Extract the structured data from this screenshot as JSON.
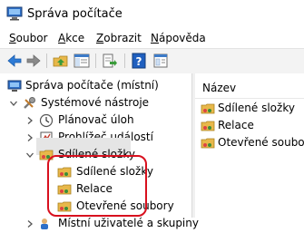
{
  "window": {
    "title": "Správa počítače"
  },
  "menu": [
    {
      "label": "Soubor",
      "key": "S",
      "rest": "oubor"
    },
    {
      "label": "Akce",
      "key": "A",
      "rest": "kce"
    },
    {
      "label": "Zobrazit",
      "key": "Z",
      "rest": "obrazit"
    },
    {
      "label": "Nápověda",
      "key": "N",
      "rest": "ápověda"
    }
  ],
  "toolbar": {
    "buttons": [
      "back-icon",
      "forward-icon",
      "up-folder-icon",
      "show-hide-tree-icon",
      "export-list-icon",
      "help-icon",
      "properties-icon"
    ]
  },
  "tree": {
    "root": "Správa počítače (místní)",
    "system_tools": "Systémové nástroje",
    "task_scheduler": "Plánovač úloh",
    "event_viewer": "Prohlížeč událostí",
    "shared_folders": "Sdílené složky",
    "shares": "Sdílené složky",
    "sessions": "Relace",
    "open_files": "Otevřené soubory",
    "local_users": "Místní uživatelé a skupiny"
  },
  "list": {
    "column_name": "Název",
    "items": [
      "Sdílené složky",
      "Relace",
      "Otevřené soubory"
    ]
  },
  "colors": {
    "annotation": "#d8101e",
    "selection": "#e5e5e5",
    "accent": "#2b5fb4"
  }
}
